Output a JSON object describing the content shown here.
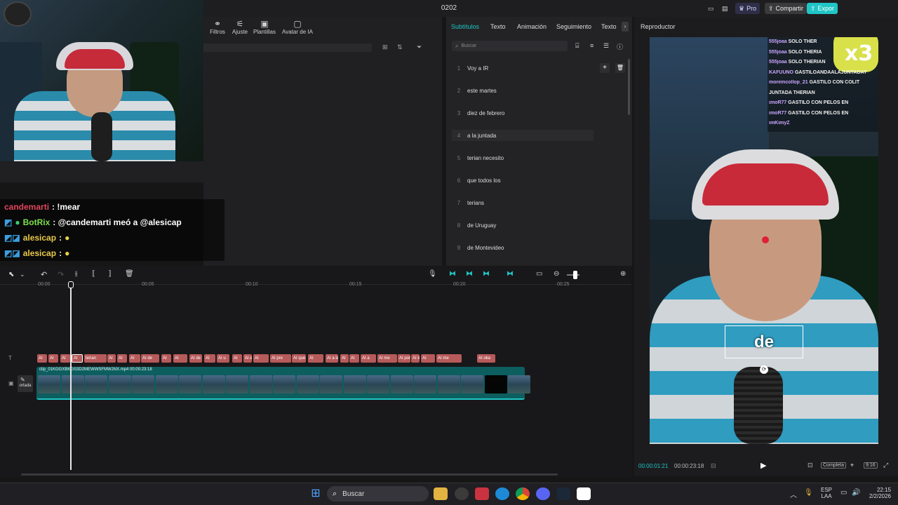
{
  "window": {
    "title": "0202"
  },
  "titlebar": {
    "pro_label": "Pro",
    "share_label": "Compartir",
    "export_label": "Expor"
  },
  "media_toolbar": {
    "items": [
      "Filtros",
      "Ajuste",
      "Plantillas",
      "Avatar de IA"
    ]
  },
  "subtitles_panel": {
    "tabs": [
      "Subtítulos",
      "Texto",
      "Animación",
      "Seguimiento",
      "Texto"
    ],
    "search_placeholder": "Buscar",
    "rows": [
      {
        "n": "1",
        "text": "Voy a IR"
      },
      {
        "n": "2",
        "text": "este martes"
      },
      {
        "n": "3",
        "text": "diez de febrero"
      },
      {
        "n": "4",
        "text": "a la juntada"
      },
      {
        "n": "5",
        "text": "terian necesito"
      },
      {
        "n": "6",
        "text": "que todos los"
      },
      {
        "n": "7",
        "text": "terians"
      },
      {
        "n": "8",
        "text": "de Uruguay"
      },
      {
        "n": "9",
        "text": "de Montevideo"
      }
    ]
  },
  "player": {
    "title": "Reproductor",
    "caption": "de",
    "time_current": "00:00:01:21",
    "time_total": "00:00:23:18",
    "mode_label": "Completa",
    "ratio_label": "9:16",
    "stream_chat": [
      {
        "user": "555joaa",
        "msg": "SOLO THER"
      },
      {
        "user": "555joaa",
        "msg": "SOLO THERIA"
      },
      {
        "user": "555joaa",
        "msg": "SOLO THERIAN"
      },
      {
        "user": "KAFUUNO",
        "msg": "GASTILOANDAALAJUNTADAT"
      },
      {
        "user": "moreincollop_21",
        "msg": "GASTILO CON COLIT"
      },
      {
        "user": "",
        "msg": "JUNTADA THERIAN"
      },
      {
        "user": "imoR77",
        "msg": "GASTILO CON PELOS EN"
      },
      {
        "user": "imoR77",
        "msg": "GASTILO CON PELOS EN"
      },
      {
        "user": "imKimyZ",
        "msg": ""
      }
    ],
    "badge": "x3"
  },
  "overlay_chat": [
    {
      "user": "candemarti",
      "msg": ": !mear",
      "color": "#e0455a"
    },
    {
      "user": "BotRix",
      "msg": ": @candemarti meó a @alesicap",
      "color": "#7ee04a"
    },
    {
      "user": "alesicap",
      "msg": ":",
      "color": "#e8c84a"
    },
    {
      "user": "alesicap",
      "msg": ":",
      "color": "#e8c84a"
    }
  ],
  "timeline": {
    "ticks": [
      "00:00",
      "00:05",
      "00:10",
      "00:15",
      "00:20",
      "00:25"
    ],
    "clip_label": "clip_01KGGXBKGS3D2MEWWSFMWJNX.mp4   00:00:23:18",
    "cover_label": "ortada",
    "subtitle_chips": [
      "AI",
      "AI",
      "AI",
      "AI",
      "terian",
      "AI",
      "AI",
      "AI",
      "AI de",
      "AI",
      "AI",
      "AI de",
      "AI",
      "AI u",
      "AI",
      "AI e",
      "AI",
      "AI pre",
      "AI que",
      "AI",
      "AI a la",
      "AI",
      "AI",
      "AI a",
      "AI me",
      "AI por",
      "AI tr",
      "AI",
      "AI me",
      "AI oka"
    ]
  },
  "taskbar": {
    "search_placeholder": "Buscar",
    "lang": "ESP",
    "lang_sub": "LAA",
    "time": "22:15",
    "date": "2/2/2026"
  },
  "colors": {
    "accent": "#20c5c5",
    "chip": "#b75a5a",
    "clip": "#0e6e6e",
    "selection": "#ffffff"
  }
}
